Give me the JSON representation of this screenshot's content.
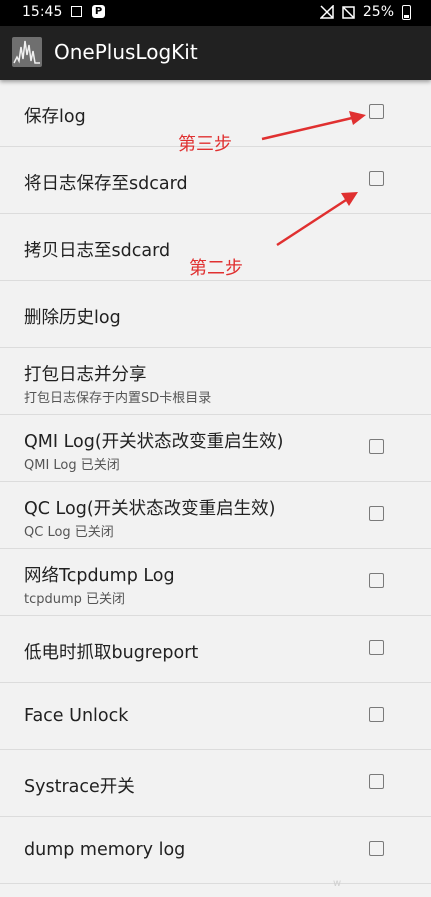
{
  "status_bar": {
    "time": "15:45",
    "battery": "25%",
    "icons": [
      "image-icon",
      "p-badge-icon",
      "no-signal-icon",
      "no-image-icon",
      "battery-icon"
    ]
  },
  "app_bar": {
    "title": "OnePlusLogKit",
    "logo_icon": "waveform-icon",
    "background": "#212121"
  },
  "list": {
    "items": [
      {
        "title": "保存log",
        "subtitle": "",
        "checkbox": true,
        "checked": false
      },
      {
        "title": "将日志保存至sdcard",
        "subtitle": "",
        "checkbox": true,
        "checked": false
      },
      {
        "title": "拷贝日志至sdcard",
        "subtitle": "",
        "checkbox": false
      },
      {
        "title": "删除历史log",
        "subtitle": "",
        "checkbox": false
      },
      {
        "title": "打包日志并分享",
        "subtitle": "打包日志保存于内置SD卡根目录",
        "checkbox": false
      },
      {
        "title": "QMI Log(开关状态改变重启生效)",
        "subtitle": "QMI Log 已关闭",
        "checkbox": true,
        "checked": false
      },
      {
        "title": "QC Log(开关状态改变重启生效)",
        "subtitle": "QC Log 已关闭",
        "checkbox": true,
        "checked": false
      },
      {
        "title": "网络Tcpdump Log",
        "subtitle": "tcpdump 已关闭",
        "checkbox": true,
        "checked": false
      },
      {
        "title": "低电时抓取bugreport",
        "subtitle": "",
        "checkbox": true,
        "checked": false
      },
      {
        "title": "Face Unlock",
        "subtitle": "",
        "checkbox": true,
        "checked": false
      },
      {
        "title": "Systrace开关",
        "subtitle": "",
        "checkbox": true,
        "checked": false
      },
      {
        "title": "dump memory log",
        "subtitle": "",
        "checkbox": true,
        "checked": false
      }
    ]
  },
  "annotations": {
    "step3": "第三步",
    "step2": "第二步",
    "color": "#e03030"
  },
  "watermark": "w"
}
